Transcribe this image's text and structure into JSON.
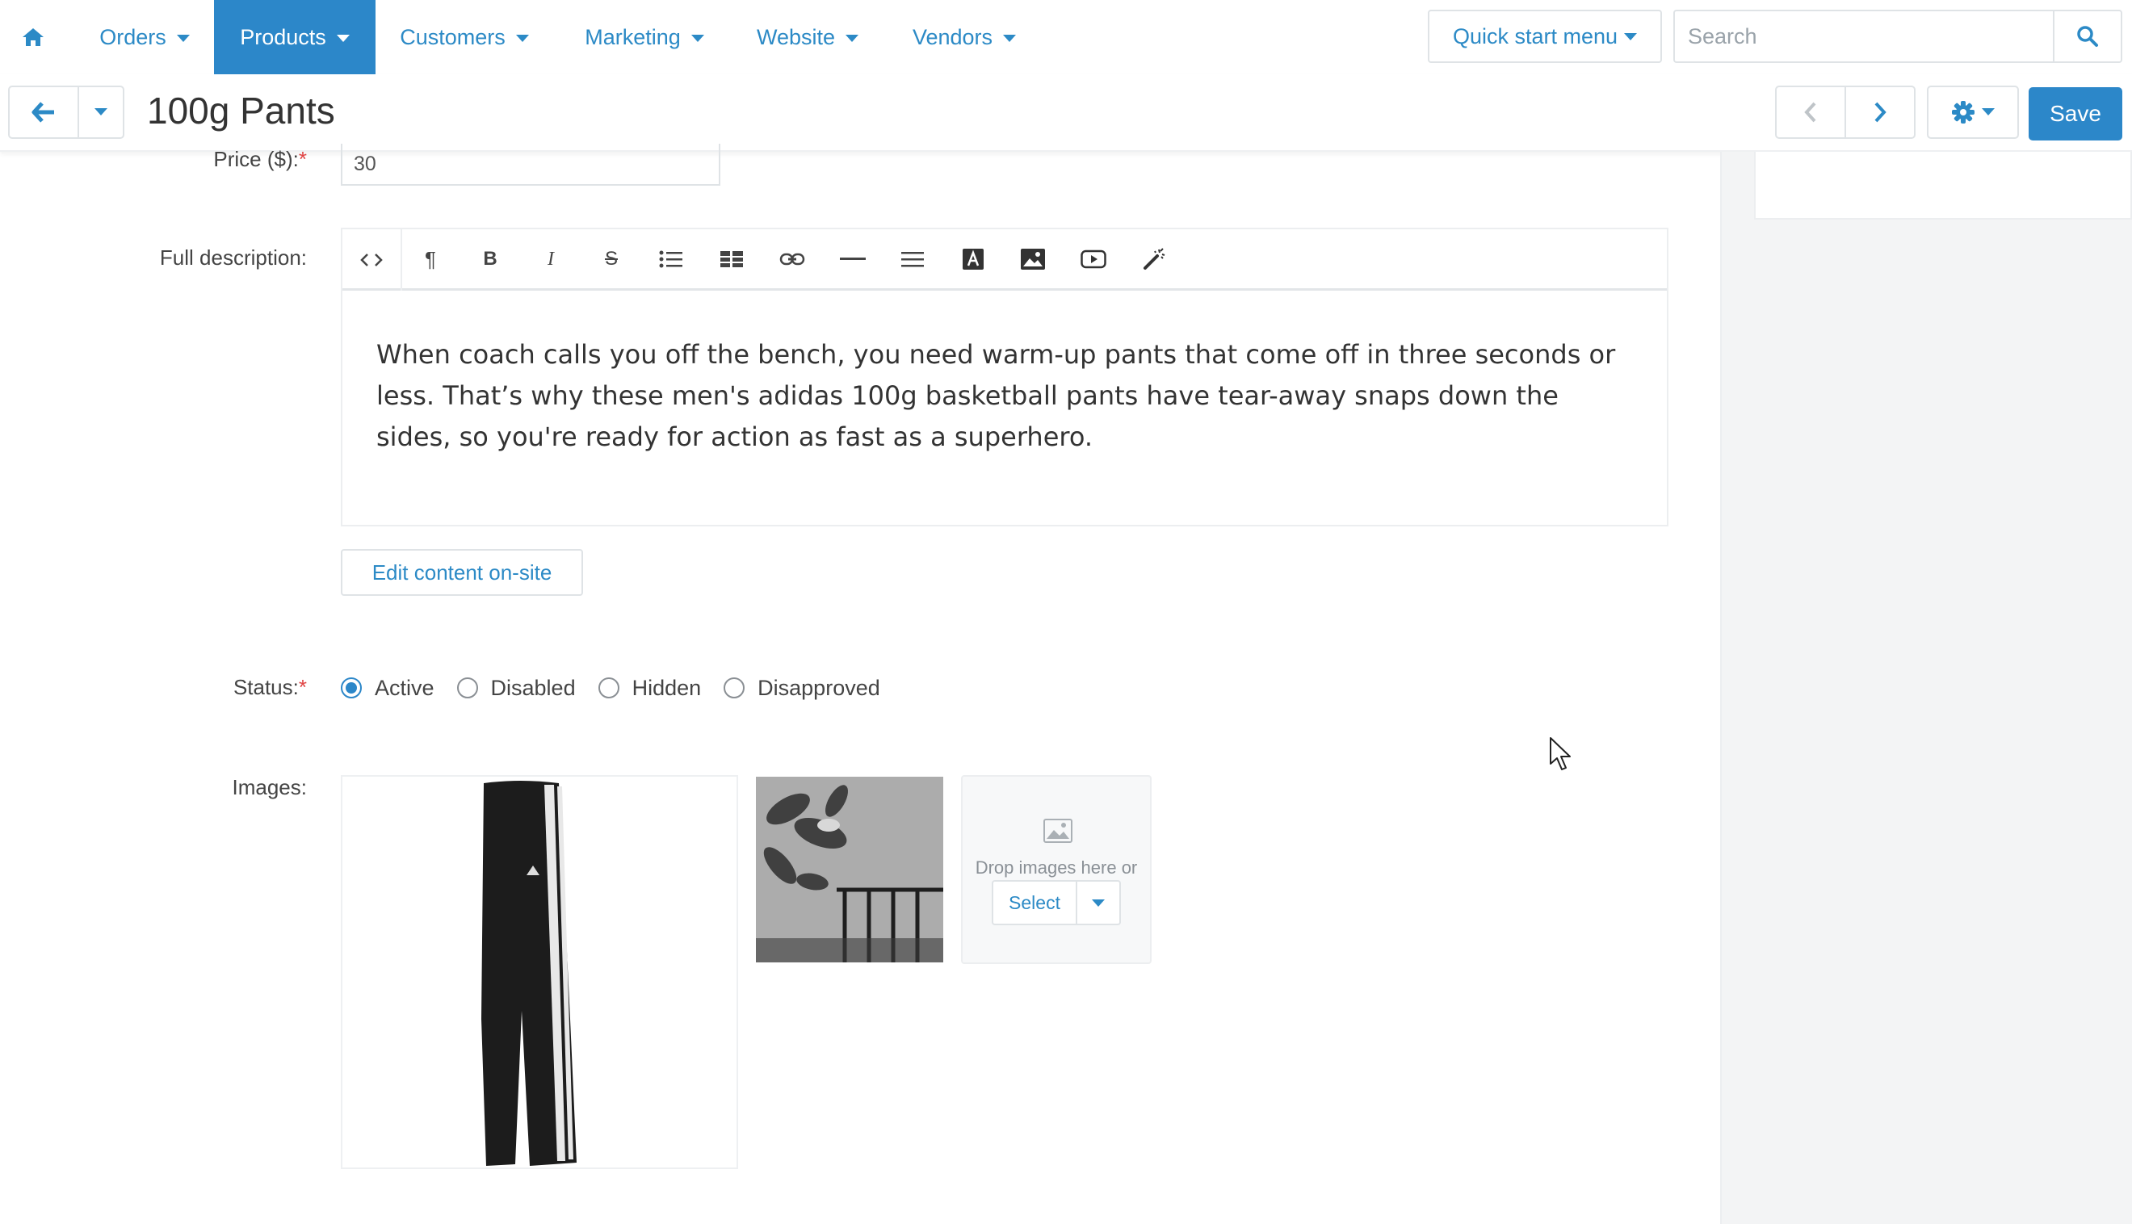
{
  "nav": {
    "items": [
      {
        "label": "Orders"
      },
      {
        "label": "Products"
      },
      {
        "label": "Customers"
      },
      {
        "label": "Marketing"
      },
      {
        "label": "Website"
      },
      {
        "label": "Vendors"
      }
    ],
    "active": "Products",
    "quick_start": "Quick start menu",
    "search_placeholder": "Search"
  },
  "page": {
    "title": "100g Pants",
    "save_label": "Save"
  },
  "form": {
    "price_label": "Price ($):",
    "price_value": "30",
    "required_mark": "*",
    "description_label": "Full description:",
    "description_text": "When coach calls you off the bench, you need warm-up pants that come off in three seconds or less. That’s why these men's adidas 100g basketball pants have tear-away snaps down the sides, so you're ready for action as fast as a superhero.",
    "edit_onsite_label": "Edit content on-site",
    "status_label": "Status:",
    "status_options": [
      "Active",
      "Disabled",
      "Hidden",
      "Disapproved"
    ],
    "status_selected": "Active",
    "images_label": "Images:",
    "drop_text": "Drop images here or",
    "select_label": "Select"
  },
  "toolbar": {
    "buttons": [
      "code-view",
      "paragraph",
      "bold",
      "italic",
      "strikethrough",
      "unordered-list",
      "table",
      "link",
      "horizontal-rule",
      "align",
      "font-color",
      "image",
      "video",
      "magic-wand"
    ],
    "bold_glyph": "B",
    "italic_glyph": "I",
    "strike_glyph": "S",
    "paragraph_glyph": "¶",
    "code_glyph": "<>"
  },
  "colors": {
    "accent": "#2c87c9",
    "link": "#2c8ac6"
  }
}
